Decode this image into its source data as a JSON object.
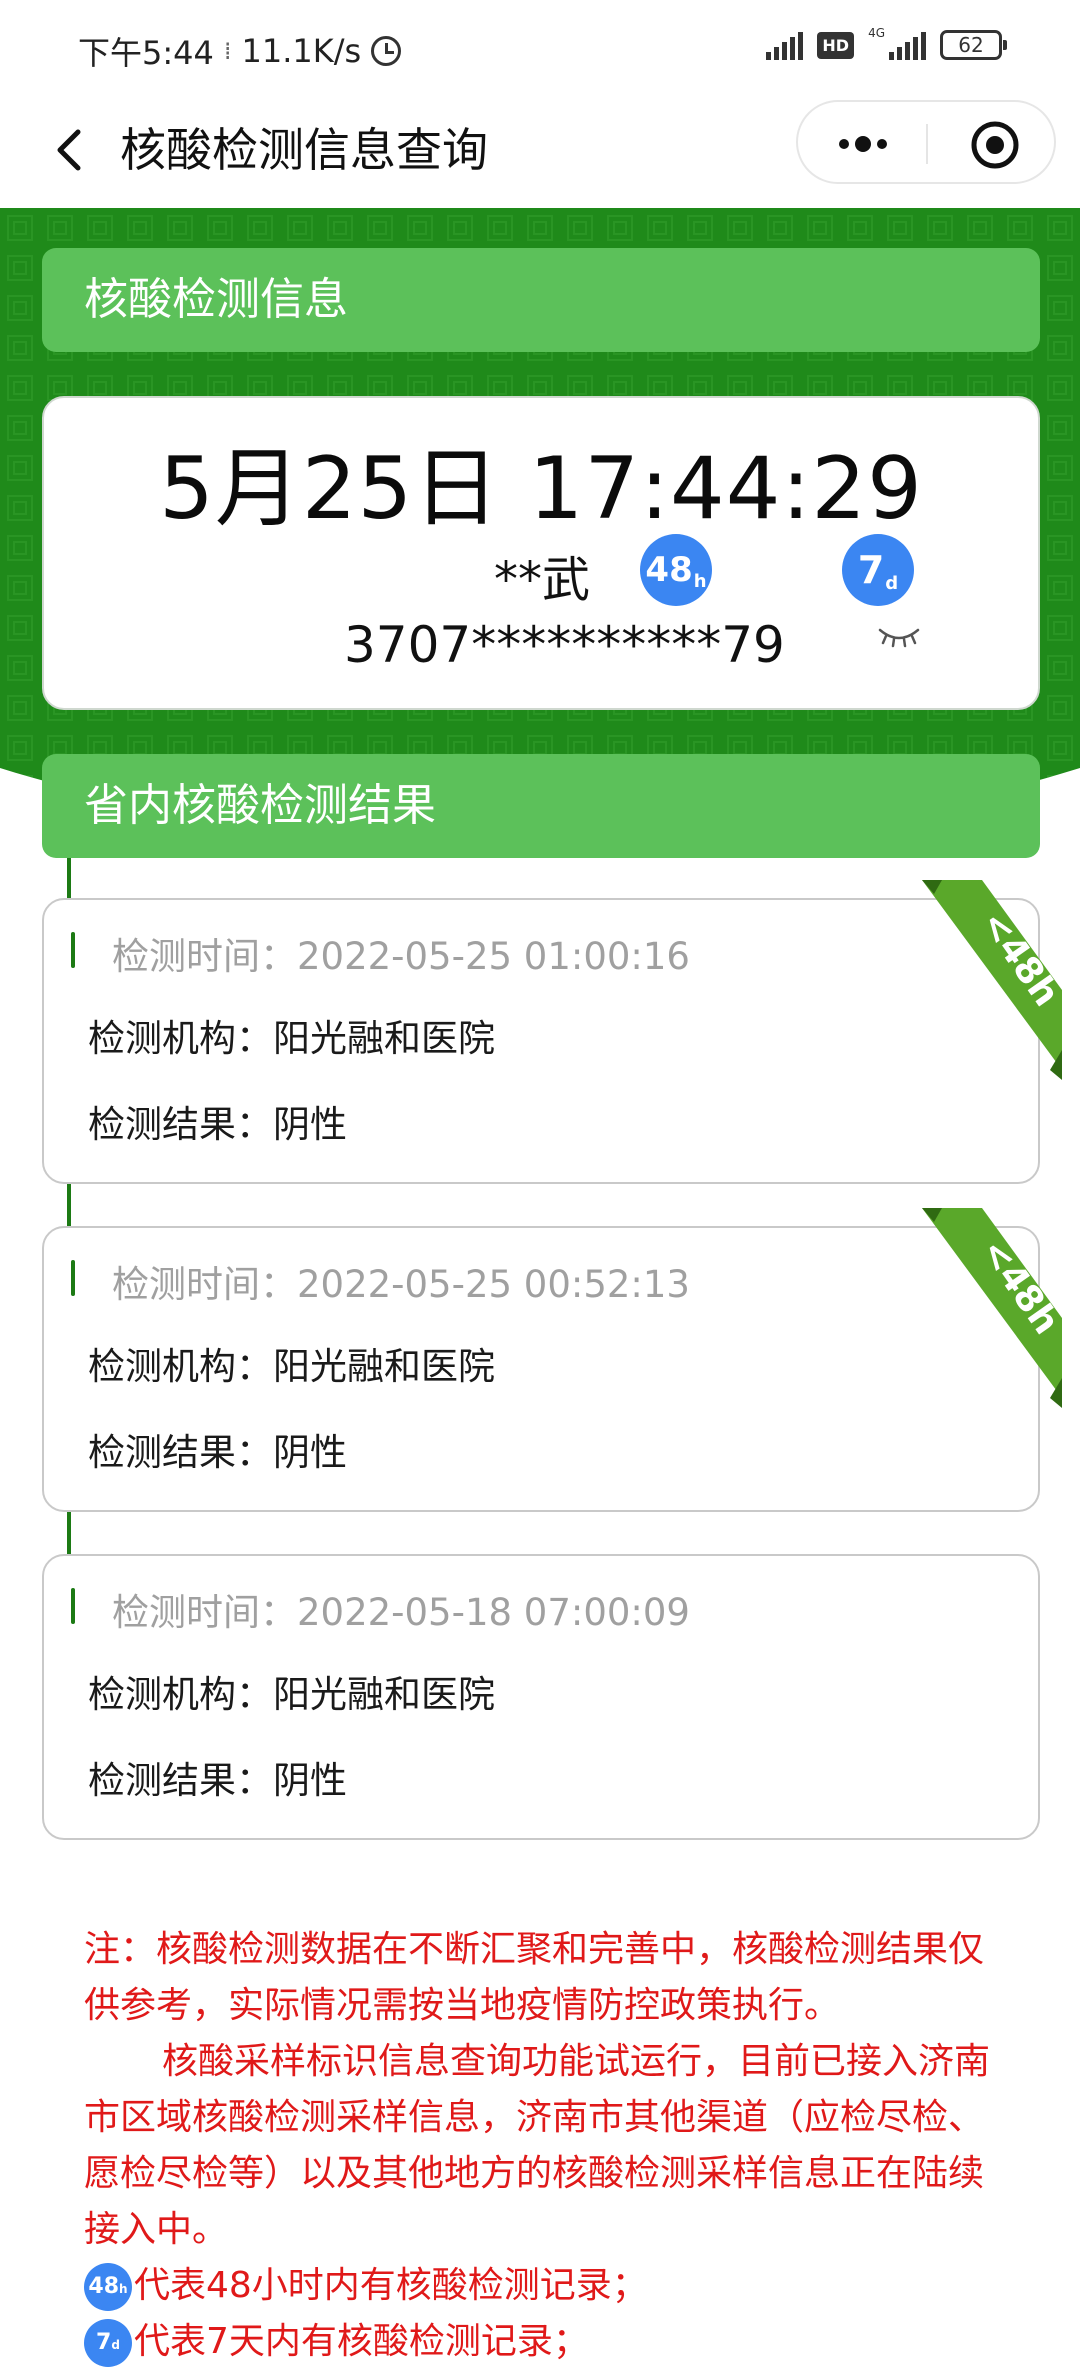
{
  "status_bar": {
    "time": "下午5:44",
    "speed": "11.1K/s",
    "hd": "HD",
    "net": "4G",
    "battery": "62"
  },
  "nav": {
    "title": "核酸检测信息查询"
  },
  "info_section": {
    "title": "核酸检测信息",
    "datetime": "5月25日 17:44:29",
    "name": "**武",
    "id_number": "3707**********79",
    "badge_48": "48",
    "badge_48_unit": "h",
    "badge_7": "7",
    "badge_7_unit": "d"
  },
  "results_section": {
    "title": "省内核酸检测结果",
    "records": [
      {
        "time_label": "检测时间：",
        "time": "2022-05-25 01:00:16",
        "org_label": "检测机构：",
        "org": "阳光融和医院",
        "result_label": "检测结果：",
        "result": "阴性",
        "ribbon": "<48h"
      },
      {
        "time_label": "检测时间：",
        "time": "2022-05-25 00:52:13",
        "org_label": "检测机构：",
        "org": "阳光融和医院",
        "result_label": "检测结果：",
        "result": "阴性",
        "ribbon": "<48h"
      },
      {
        "time_label": "检测时间：",
        "time": "2022-05-18 07:00:09",
        "org_label": "检测机构：",
        "org": "阳光融和医院",
        "result_label": "检测结果：",
        "result": "阴性"
      }
    ]
  },
  "note": {
    "para1": "注：核酸检测数据在不断汇聚和完善中，核酸检测结果仅供参考，实际情况需按当地疫情防控政策执行。",
    "para2": "核酸采样标识信息查询功能试运行，目前已接入济南市区域核酸检测采样信息，济南市其他渠道（应检尽检、愿检尽检等）以及其他地方的核酸检测采样信息正在陆续接入中。",
    "legend_48_badge": "48",
    "legend_48_badge_unit": "h",
    "legend_48": "代表48小时内有核酸检测记录；",
    "legend_7_badge": "7",
    "legend_7_badge_unit": "d",
    "legend_7": "代表7天内有核酸检测记录；"
  },
  "colors": {
    "green_dark": "#1f8a1a",
    "green_header": "#5cc15a",
    "badge_blue": "#3b86f2",
    "note_red": "#e01919"
  }
}
